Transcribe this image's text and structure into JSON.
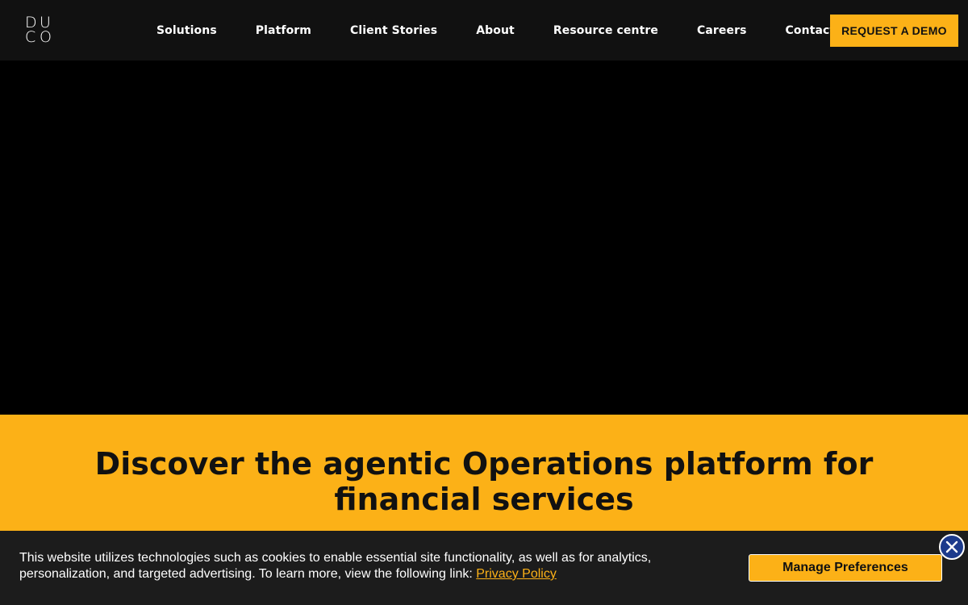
{
  "logo": {
    "letters": [
      "D",
      "U",
      "C",
      "O"
    ]
  },
  "nav": {
    "items": [
      {
        "label": "Solutions"
      },
      {
        "label": "Platform"
      },
      {
        "label": "Client Stories"
      },
      {
        "label": "About"
      },
      {
        "label": "Resource centre"
      },
      {
        "label": "Careers"
      },
      {
        "label": "Contact"
      }
    ],
    "cta_label": "REQUEST A DEMO"
  },
  "hero": {
    "headline": "Discover the agentic Operations platform for financial services"
  },
  "cookie": {
    "text": "This website utilizes technologies such as cookies to enable essential site functionality, as well as for analytics, personalization, and targeted advertising. To learn more, view the following link: ",
    "link_label": "Privacy Policy",
    "button_label": "Manage Preferences",
    "close_icon": "close-icon"
  },
  "colors": {
    "accent": "#FCB117",
    "nav_bg": "#111111",
    "cookie_bg": "#1C1C1C",
    "close_bg": "#1C3A8C"
  }
}
